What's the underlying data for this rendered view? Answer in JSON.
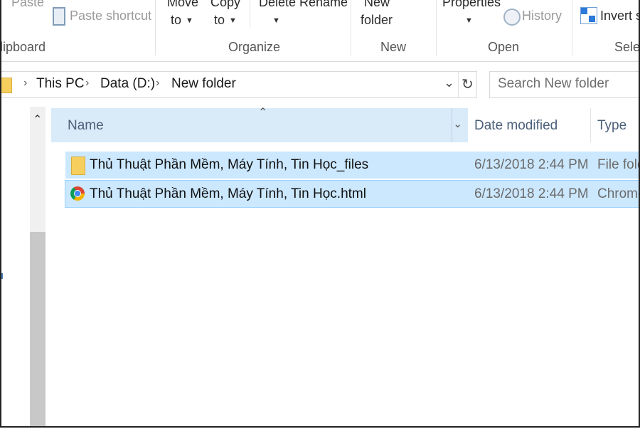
{
  "ribbon": {
    "clipboard": {
      "paste_label": "Paste",
      "paste_shortcut_label": "Paste shortcut",
      "group_label": "lipboard"
    },
    "organize": {
      "move_label": "Move",
      "move_to_label": "to",
      "copy_label": "Copy",
      "copy_to_label": "to",
      "delete_label": "Delete",
      "rename_label": "Rename",
      "group_label": "Organize"
    },
    "new": {
      "new_label": "New",
      "folder_label": "folder",
      "group_label": "New"
    },
    "open": {
      "properties_label": "Properties",
      "history_label": "History",
      "group_label": "Open"
    },
    "select": {
      "invert_label": "Invert se",
      "group_label": "Selec"
    }
  },
  "address": {
    "crumbs": [
      "This PC",
      "Data (D:)",
      "New folder"
    ],
    "search_placeholder": "Search New folder"
  },
  "columns": {
    "name": "Name",
    "date_modified": "Date modified",
    "type": "Type"
  },
  "files": [
    {
      "name": "Thủ Thuật Phần Mềm, Máy Tính, Tin Học_files",
      "date": "6/13/2018 2:44 PM",
      "type": "File fold",
      "icon": "folder-icon"
    },
    {
      "name": "Thủ Thuật Phần Mềm, Máy Tính, Tin Học.html",
      "date": "6/13/2018 2:44 PM",
      "type": "Chrome",
      "icon": "chrome-icon"
    }
  ],
  "colors": {
    "selection": "#cce8ff",
    "selection_border": "#99d1ff",
    "header_hover": "#d9ebf9",
    "folder": "#f6cf5e"
  }
}
